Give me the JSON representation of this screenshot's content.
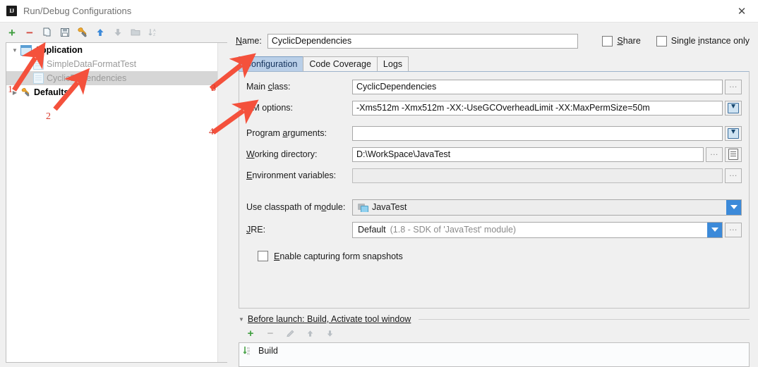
{
  "window": {
    "title": "Run/Debug Configurations",
    "app_icon": "intellij-idea-icon",
    "close_label": "✕"
  },
  "left_toolbar": {
    "buttons": [
      {
        "name": "add-configuration-button",
        "icon": "plus-icon",
        "label": "+",
        "enabled": true
      },
      {
        "name": "remove-configuration-button",
        "icon": "minus-icon",
        "label": "−",
        "enabled": true
      },
      {
        "name": "copy-configuration-button",
        "icon": "copy-icon",
        "label": "",
        "enabled": true
      },
      {
        "name": "save-configuration-button",
        "icon": "save-icon",
        "label": "",
        "enabled": true
      },
      {
        "name": "edit-defaults-button",
        "icon": "wrench-icon",
        "label": "",
        "enabled": true
      },
      {
        "name": "move-up-button",
        "icon": "arrow-up-icon",
        "label": "",
        "enabled": true
      },
      {
        "name": "move-down-button",
        "icon": "arrow-down-icon",
        "label": "",
        "enabled": false
      },
      {
        "name": "move-into-folder-button",
        "icon": "folder-icon",
        "label": "",
        "enabled": false
      },
      {
        "name": "sort-configurations-button",
        "icon": "sort-az-icon",
        "label": "",
        "enabled": false
      }
    ]
  },
  "tree": {
    "nodes": [
      {
        "label": "Application",
        "icon": "application-icon",
        "level": 0,
        "expanded": true,
        "bold": true,
        "selected": false,
        "dim": false
      },
      {
        "label": "SimpleDataFormatTest",
        "icon": "run-config-icon",
        "level": 1,
        "expanded": null,
        "bold": false,
        "selected": false,
        "dim": true
      },
      {
        "label": "CyclicDependencies",
        "icon": "run-config-icon",
        "level": 1,
        "expanded": null,
        "bold": false,
        "selected": true,
        "dim": true
      },
      {
        "label": "Defaults",
        "icon": "wrench-icon",
        "level": 0,
        "expanded": false,
        "bold": true,
        "selected": false,
        "dim": false
      }
    ]
  },
  "header": {
    "name_label": "Name:",
    "name_value": "CyclicDependencies",
    "share_label": "Share",
    "share_checked": false,
    "single_instance_label": "Single instance only",
    "single_instance_checked": false
  },
  "tabs": [
    {
      "label": "Configuration",
      "active": true
    },
    {
      "label": "Code Coverage",
      "active": false
    },
    {
      "label": "Logs",
      "active": false
    }
  ],
  "form": {
    "main_class": {
      "label": "Main class:",
      "value": "CyclicDependencies",
      "browse_label": "…"
    },
    "vm_options": {
      "label": "VM options:",
      "value": "-Xms512m  -Xmx512m   -XX:-UseGCOverheadLimit   -XX:MaxPermSize=50m",
      "expand_icon": "expand-editor-icon"
    },
    "program_arguments": {
      "label": "Program arguments:",
      "value": "",
      "expand_icon": "expand-editor-icon"
    },
    "working_directory": {
      "label": "Working directory:",
      "value": "D:\\WorkSpace\\JavaTest",
      "browse_label": "…",
      "macros_icon": "macros-list-icon"
    },
    "environment_variables": {
      "label": "Environment variables:",
      "value": "",
      "browse_label": "…"
    },
    "classpath_module": {
      "label": "Use classpath of module:",
      "value": "JavaTest",
      "icon": "module-icon"
    },
    "jre": {
      "label": "JRE:",
      "value": "Default",
      "value_hint": "(1.8 - SDK of 'JavaTest' module)",
      "browse_label": "…"
    },
    "form_snapshots": {
      "label": "Enable capturing form snapshots",
      "checked": false
    }
  },
  "before_launch": {
    "header": "Before launch: Build, Activate tool window",
    "toolbar": [
      {
        "name": "add-task-button",
        "icon": "plus-icon",
        "label": "+",
        "enabled": true
      },
      {
        "name": "remove-task-button",
        "icon": "minus-icon",
        "label": "−",
        "enabled": false
      },
      {
        "name": "edit-task-button",
        "icon": "pencil-icon",
        "label": "",
        "enabled": false
      },
      {
        "name": "task-move-up-button",
        "icon": "arrow-up-icon",
        "label": "",
        "enabled": false
      },
      {
        "name": "task-move-down-button",
        "icon": "arrow-down-icon",
        "label": "",
        "enabled": false
      }
    ],
    "tasks": [
      {
        "label": "Build",
        "icon": "compile-icon"
      }
    ]
  },
  "annotations": [
    {
      "number": "1",
      "target": "application-tree-node"
    },
    {
      "number": "2",
      "target": "cyclic-dependencies-tree-node"
    },
    {
      "number": "3",
      "target": "configuration-tab"
    },
    {
      "number": "4",
      "target": "program-arguments-field"
    }
  ],
  "colors": {
    "accent_blue": "#3c8ad9",
    "active_tab": "#b9cfe8",
    "annotation_red": "#f4513c",
    "add_green": "#3f9e3f",
    "remove_red": "#d44a3f"
  }
}
